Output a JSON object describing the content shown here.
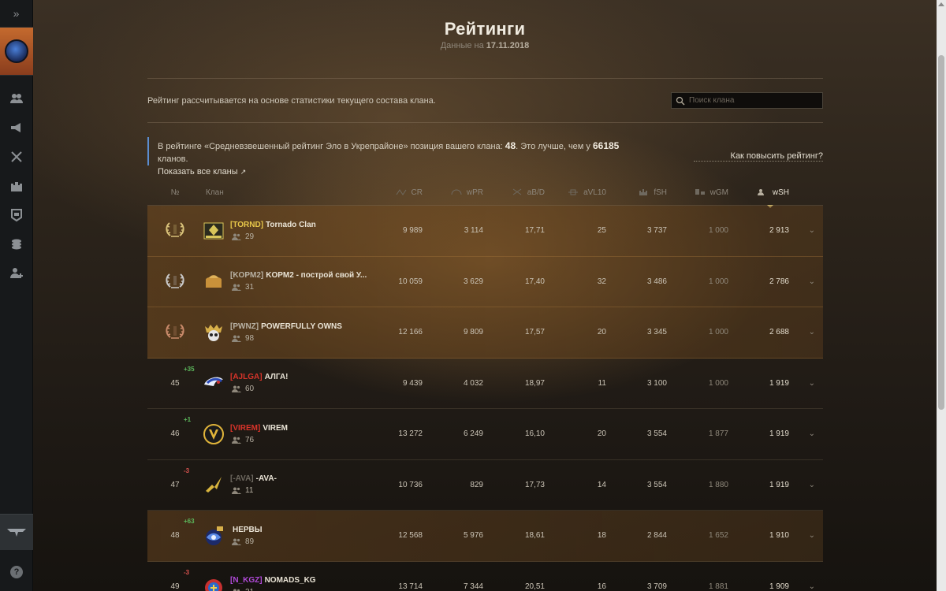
{
  "page": {
    "title": "Рейтинги",
    "date_prefix": "Данные на",
    "date": "17.11.2018",
    "description": "Рейтинг рассчитывается на основе статистики текущего состава клана.",
    "search_placeholder": "Поиск клана"
  },
  "info": {
    "text1": "В рейтинге «Средневзвешенный рейтинг Эло в Укрепрайоне» позиция вашего клана:",
    "position": "48",
    "text2": ". Это лучше, чем у",
    "count": "66185",
    "text3": "кланов.",
    "show_all": "Показать все кланы",
    "improve_link": "Как повысить рейтинг?"
  },
  "sidebar": {
    "expand_icon": "double-chevron-right",
    "items": [
      "clan-members-icon",
      "recruitment-icon",
      "battles-icon",
      "stronghold-icon",
      "achievements-icon",
      "treasury-icon",
      "add-member-icon"
    ],
    "help": "?"
  },
  "table": {
    "headers": {
      "num": "№",
      "clan": "Клан",
      "cr": "CR",
      "wpr": "wPR",
      "abd": "aB/D",
      "avl10": "aVL10",
      "fsh": "fSH",
      "wgm": "wGM",
      "wsh": "wSH"
    },
    "sorted_by": "wSH",
    "rows": [
      {
        "rank": "1",
        "medal": "gold",
        "tag": "[TORND]",
        "tag_color": "#e8c84a",
        "name": "Tornado Clan",
        "members": "29",
        "cr": "9 989",
        "wpr": "3 114",
        "abd": "17,71",
        "avl10": "25",
        "fsh": "3 737",
        "wgm": "1 000",
        "wsh": "2 913"
      },
      {
        "rank": "2",
        "medal": "silver",
        "tag": "[KOPM2]",
        "tag_color": "#b9b2a4",
        "name": "KOPM2 - построй свой У...",
        "members": "31",
        "cr": "10 059",
        "wpr": "3 629",
        "abd": "17,40",
        "avl10": "32",
        "fsh": "3 486",
        "wgm": "1 000",
        "wsh": "2 786"
      },
      {
        "rank": "3",
        "medal": "bronze",
        "tag": "[PWNZ]",
        "tag_color": "#b9b2a4",
        "name": "POWERFULLY OWNS",
        "members": "98",
        "cr": "12 166",
        "wpr": "9 809",
        "abd": "17,57",
        "avl10": "20",
        "fsh": "3 345",
        "wgm": "1 000",
        "wsh": "2 688"
      },
      {
        "rank": "45",
        "delta": "+35",
        "tag": "[AJLGA]",
        "tag_color": "#d9342a",
        "name": "АЛГА!",
        "members": "60",
        "cr": "9 439",
        "wpr": "4 032",
        "abd": "18,97",
        "avl10": "11",
        "fsh": "3 100",
        "wgm": "1 000",
        "wsh": "1 919"
      },
      {
        "rank": "46",
        "delta": "+1",
        "tag": "[VIREM]",
        "tag_color": "#d9342a",
        "name": "VIREM",
        "members": "76",
        "cr": "13 272",
        "wpr": "6 249",
        "abd": "16,10",
        "avl10": "20",
        "fsh": "3 554",
        "wgm": "1 877",
        "wsh": "1 919"
      },
      {
        "rank": "47",
        "delta": "-3",
        "tag": "[-AVA]",
        "tag_color": "#6d685f",
        "name": "-AVA-",
        "members": "11",
        "cr": "10 736",
        "wpr": "829",
        "abd": "17,73",
        "avl10": "14",
        "fsh": "3 554",
        "wgm": "1 880",
        "wsh": "1 919"
      },
      {
        "rank": "48",
        "delta": "+63",
        "tag": "",
        "tag_color": "#3a4ad0",
        "name": "НЕРВЫ",
        "members": "89",
        "cr": "12 568",
        "wpr": "5 976",
        "abd": "18,61",
        "avl10": "18",
        "fsh": "2 844",
        "wgm": "1 652",
        "wsh": "1 910",
        "own": true
      },
      {
        "rank": "49",
        "delta": "-3",
        "tag": "[N_KGZ]",
        "tag_color": "#b04ad8",
        "name": "NOMADS_KG",
        "members": "21",
        "cr": "13 714",
        "wpr": "7 344",
        "abd": "20,51",
        "avl10": "16",
        "fsh": "3 709",
        "wgm": "1 881",
        "wsh": "1 909"
      }
    ]
  }
}
